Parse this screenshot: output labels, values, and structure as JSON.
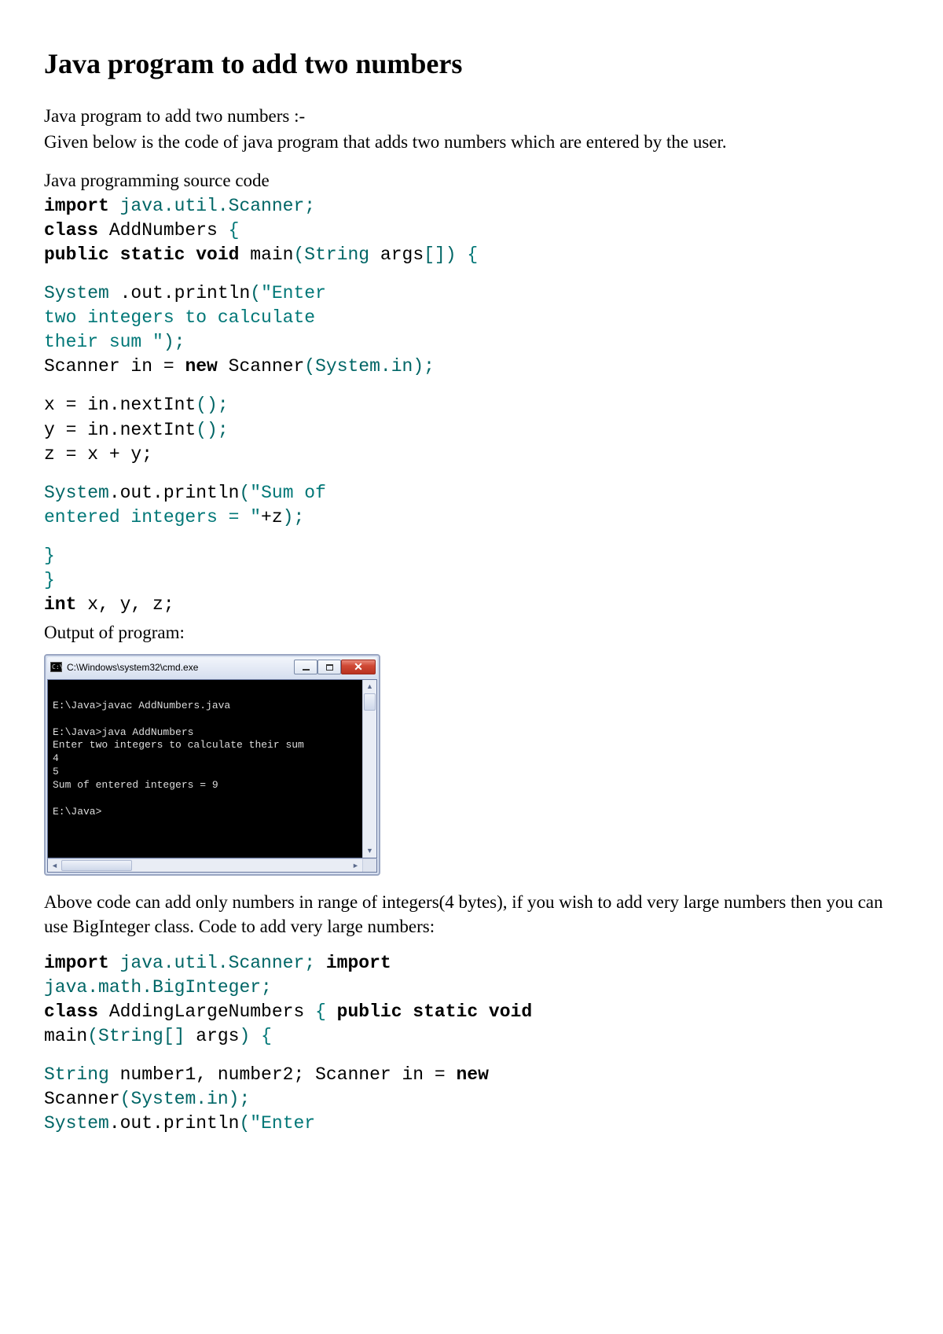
{
  "title": "Java program to add two numbers",
  "intro1": "Java program to add two numbers :-",
  "intro2": "Given below is the code of java program that adds two numbers which are entered by the user.",
  "source_label": "Java programming source code",
  "code1": {
    "kw_import": "import",
    "import_pkg": " java.util.Scanner;",
    "kw_class": "class",
    "class_name": " AddNumbers ",
    "brace_open": "{",
    "kw_public": "public",
    "kw_static": " static",
    "kw_void": " void",
    "main_name": " main",
    "main_sig_open": "(",
    "main_sig_type": "String",
    "main_sig_rest": " args",
    "main_sig_arr": "[])",
    "main_brace": " {",
    "sys": "System",
    "out_print": " .out.println",
    "print_paren": "(",
    "print_str1": "\"Enter\ntwo integers to calculate\ntheir sum \"",
    "print_close": ");",
    "scanner_decl1": "Scanner in = ",
    "kw_new": "new",
    "scanner_decl2": " Scanner",
    "scanner_arg_open": "(",
    "scanner_arg": "System.in",
    "scanner_arg_close": ");",
    "x_line": "x = in.nextInt",
    "x_call": "();",
    "y_line": "y = in.nextInt",
    "y_call": "();",
    "z_line": "z = x + y;",
    "sys2": "System",
    "out_print2": ".out.println",
    "print2_paren": "(",
    "print2_str": "\"Sum of\nentered integers = \"",
    "print2_plus": "+z",
    "print2_close": ");",
    "brace_close1": "}",
    "brace_close2": "}",
    "kw_int": "int",
    "int_vars": " x, y, z;"
  },
  "output_label": "Output of program:",
  "cmd": {
    "title": "C:\\Windows\\system32\\cmd.exe",
    "text": "\nE:\\Java>javac AddNumbers.java\n\nE:\\Java>java AddNumbers\nEnter two integers to calculate their sum\n4\n5\nSum of entered integers = 9\n\nE:\\Java>"
  },
  "para2": "Above code can add only numbers in range of integers(4 bytes), if you wish to add very large numbers then you can use BigInteger class. Code to add very large numbers:",
  "code2": {
    "kw_import1": "import",
    "import_pkg1": " java.util.Scanner;",
    "kw_import2": " import",
    "import_pkg2": "java.math.BigInteger;",
    "kw_class": "class",
    "class_name": " AddingLargeNumbers ",
    "brace_open": "{",
    "kw_public": " public",
    "kw_static": " static",
    "kw_void": " void",
    "main_name": "main",
    "main_sig_open": "(",
    "main_sig_type": "String",
    "main_sig_arr": "[]",
    "main_sig_rest": " args",
    "main_sig_close": ")",
    "main_brace": " {",
    "str_type": "String",
    "vars": " number1, number2; Scanner in = ",
    "kw_new": "new",
    "scanner_line": "Scanner",
    "scanner_arg_open": "(",
    "scanner_arg": "System.in",
    "scanner_arg_close": ");",
    "sys": "System",
    "out_print": ".out.println",
    "print_paren": "(",
    "print_str": "\"Enter"
  }
}
